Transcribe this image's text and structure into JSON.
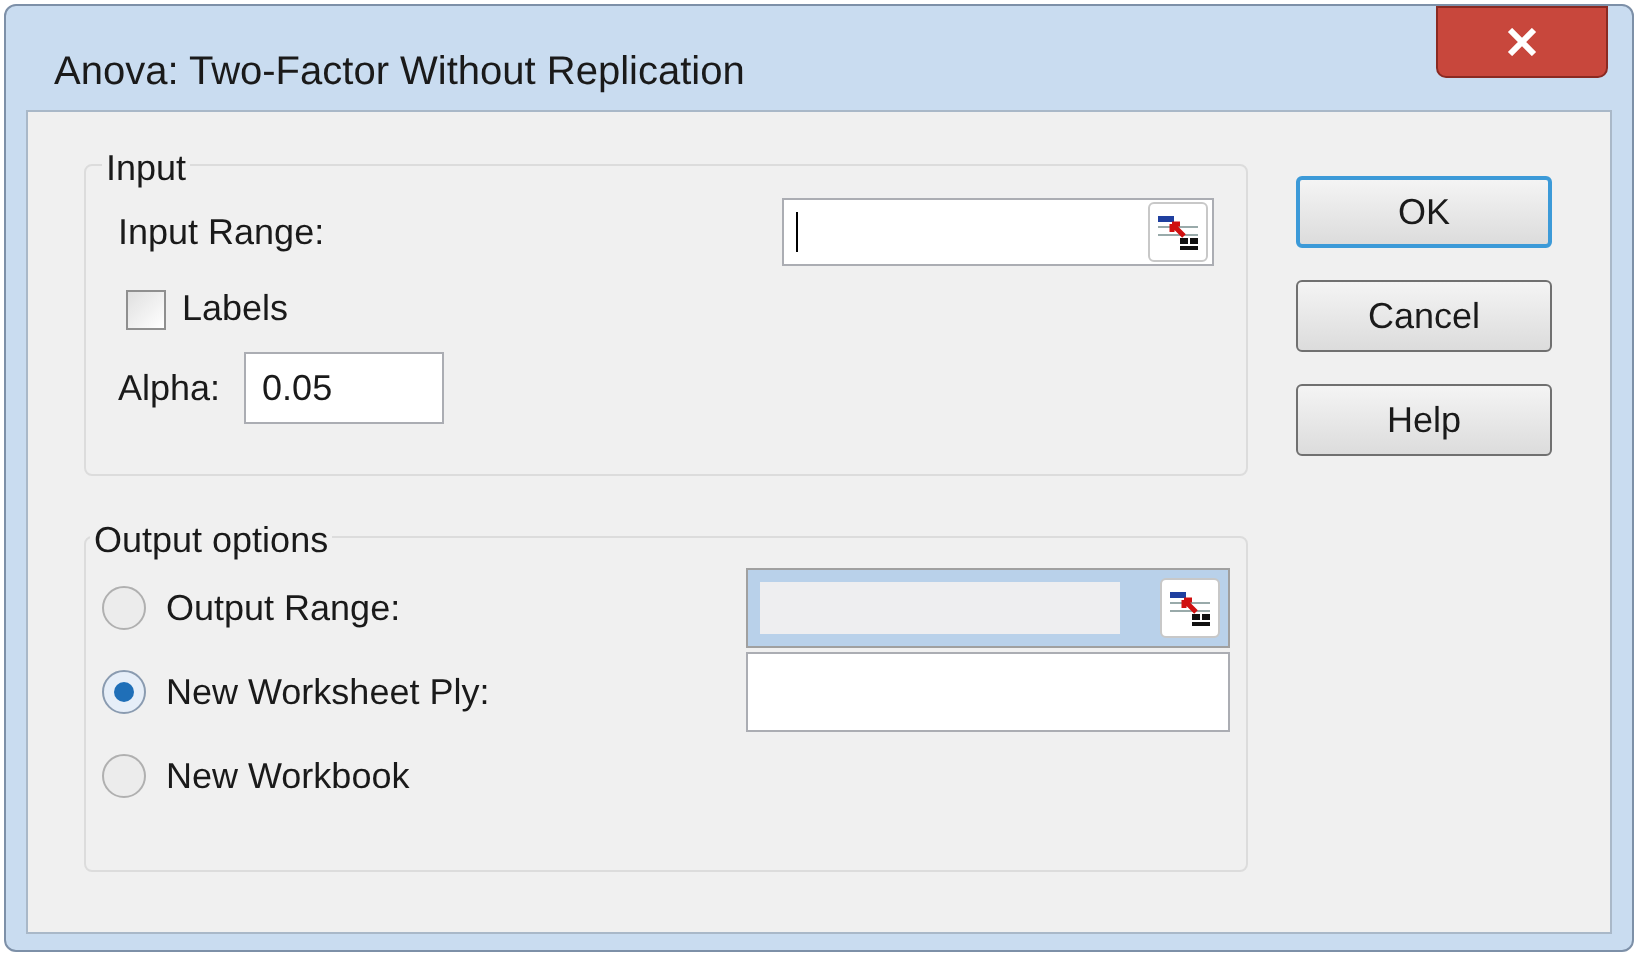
{
  "window": {
    "title": "Anova: Two-Factor Without Replication"
  },
  "input_group": {
    "title": "Input",
    "input_range": {
      "label": "Input Range:",
      "focused": true
    },
    "labels_checkbox": {
      "label": "Labels",
      "checked": false
    },
    "alpha": {
      "label": "Alpha:",
      "value": "0.05"
    }
  },
  "output_group": {
    "title": "Output options",
    "options": [
      {
        "label": "Output Range:",
        "selected": false,
        "kind": "range"
      },
      {
        "label": "New Worksheet Ply:",
        "selected": true,
        "kind": "field"
      },
      {
        "label": "New Workbook",
        "selected": false,
        "kind": "plain"
      }
    ]
  },
  "buttons": [
    {
      "label": "OK",
      "default": true
    },
    {
      "label": "Cancel",
      "default": false
    },
    {
      "label": "Help",
      "default": false
    }
  ]
}
